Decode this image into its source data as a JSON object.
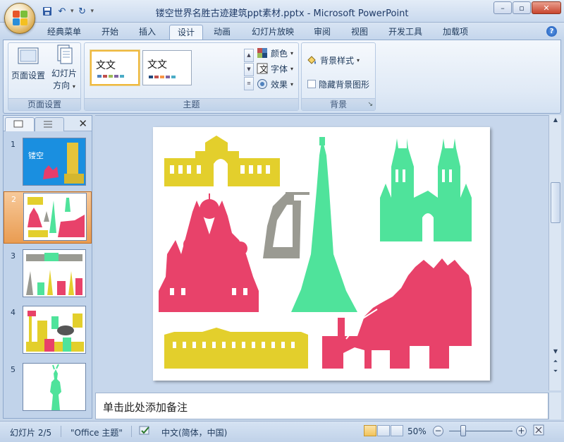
{
  "window": {
    "title": "镂空世界名胜古迹建筑ppt素材.pptx - Microsoft PowerPoint",
    "controls": [
      "minimize",
      "maximize",
      "close"
    ]
  },
  "quick_access": [
    "save-icon",
    "undo-icon",
    "redo-icon",
    "customize-dropdown-icon"
  ],
  "tabs": [
    {
      "label": "经典菜单",
      "active": false
    },
    {
      "label": "开始",
      "active": false
    },
    {
      "label": "插入",
      "active": false
    },
    {
      "label": "设计",
      "active": true
    },
    {
      "label": "动画",
      "active": false
    },
    {
      "label": "幻灯片放映",
      "active": false
    },
    {
      "label": "审阅",
      "active": false
    },
    {
      "label": "视图",
      "active": false
    },
    {
      "label": "开发工具",
      "active": false
    },
    {
      "label": "加载项",
      "active": false
    }
  ],
  "ribbon": {
    "page_setup": {
      "group_label": "页面设置",
      "page_setup_label": "页面设置",
      "orientation_label_1": "幻灯片",
      "orientation_label_2": "方向"
    },
    "themes": {
      "group_label": "主题",
      "tiles": [
        {
          "text": "文文",
          "selected": true,
          "colors": [
            "#4f81bd",
            "#c0504d",
            "#9bbb59",
            "#8064a2",
            "#4bacc6"
          ]
        },
        {
          "text": "文文",
          "selected": false,
          "colors": [
            "#1f497d",
            "#c0504d",
            "#f79646",
            "#8064a2",
            "#4bacc6"
          ]
        }
      ],
      "colors_label": "颜色",
      "fonts_label": "字体",
      "effects_label": "效果"
    },
    "background": {
      "group_label": "背景",
      "styles_label": "背景样式",
      "hide_graphics_label": "隐藏背景图形",
      "hide_graphics_checked": false
    }
  },
  "slides_pane": {
    "tabs": [
      "slides-tab",
      "outline-tab"
    ],
    "slides": [
      {
        "number": "1",
        "selected": false
      },
      {
        "number": "2",
        "selected": true
      },
      {
        "number": "3",
        "selected": false
      },
      {
        "number": "4",
        "selected": false
      },
      {
        "number": "5",
        "selected": false
      }
    ],
    "thumb1_text": "镂空"
  },
  "notes": {
    "placeholder": "单击此处添加备注"
  },
  "statusbar": {
    "slide_info": "幻灯片 2/5",
    "theme": "\"Office 主题\"",
    "language": "中文(简体，中国)",
    "zoom": "50%",
    "zoom_fraction": 0.5
  },
  "colors": {
    "yellow": "#e3cf2c",
    "green": "#4fe39b",
    "pink": "#e8426a",
    "gray": "#9a9a92"
  }
}
